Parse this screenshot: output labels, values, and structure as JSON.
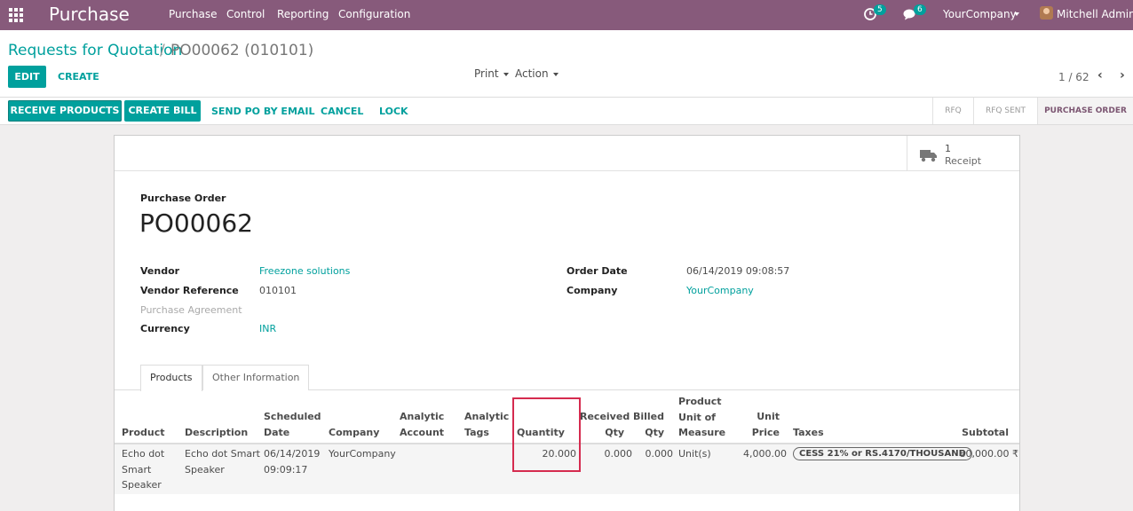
{
  "navbar": {
    "brand": "Purchase",
    "menu": [
      "Purchase",
      "Control",
      "Reporting",
      "Configuration"
    ],
    "activity_count": "5",
    "message_count": "6",
    "company": "YourCompany",
    "user": "Mitchell Admin"
  },
  "breadcrumb": {
    "parent": "Requests for Quotation",
    "separator": "/",
    "current": "PO00062 (010101)"
  },
  "control": {
    "edit_label": "EDIT",
    "create_label": "CREATE",
    "print_label": "Print",
    "action_label": "Action",
    "pager": "1 / 62"
  },
  "statusbar": {
    "buttons": [
      "RECEIVE PRODUCTS",
      "CREATE BILL",
      "SEND PO BY EMAIL",
      "CANCEL",
      "LOCK"
    ],
    "stages": [
      "RFQ",
      "RFQ SENT",
      "PURCHASE ORDER"
    ],
    "active_stage": "PURCHASE ORDER"
  },
  "smart_button": {
    "count": "1",
    "label": "Receipt",
    "icon": "truck-icon"
  },
  "form": {
    "title_label": "Purchase Order",
    "name": "PO00062",
    "vendor_label": "Vendor",
    "vendor": "Freezone solutions",
    "vendor_ref_label": "Vendor Reference",
    "vendor_ref": "010101",
    "agreement_label": "Purchase Agreement",
    "currency_label": "Currency",
    "currency": "INR",
    "order_date_label": "Order Date",
    "order_date": "06/14/2019 09:08:57",
    "company_label": "Company",
    "company": "YourCompany"
  },
  "tabs": [
    "Products",
    "Other Information"
  ],
  "table": {
    "headers": {
      "product": "Product",
      "description": "Description",
      "scheduled": "Scheduled\nDate",
      "company": "Company",
      "analytic_account": "Analytic\nAccount",
      "analytic_tags": "Analytic\nTags",
      "quantity": "Quantity",
      "received": "Received\nQty",
      "billed": "Billed\nQty",
      "uom": "Product\nUnit of\nMeasure",
      "unit_price": "Unit\nPrice",
      "taxes": "Taxes",
      "subtotal": "Subtotal"
    },
    "row": {
      "product": "Echo dot\nSmart\nSpeaker",
      "description": "Echo dot Smart\nSpeaker",
      "scheduled": "06/14/2019\n09:09:17",
      "company": "YourCompany",
      "quantity": "20.000",
      "received": "0.000",
      "billed": "0.000",
      "uom": "Unit(s)",
      "unit_price": "4,000.00",
      "tax": "CESS 21% or RS.4170/THOUSAND",
      "subtotal": "80,000.00 ₹"
    }
  },
  "colors": {
    "navbar": "#875a7b",
    "accent": "#00a09d",
    "highlight": "#d52b4f"
  }
}
